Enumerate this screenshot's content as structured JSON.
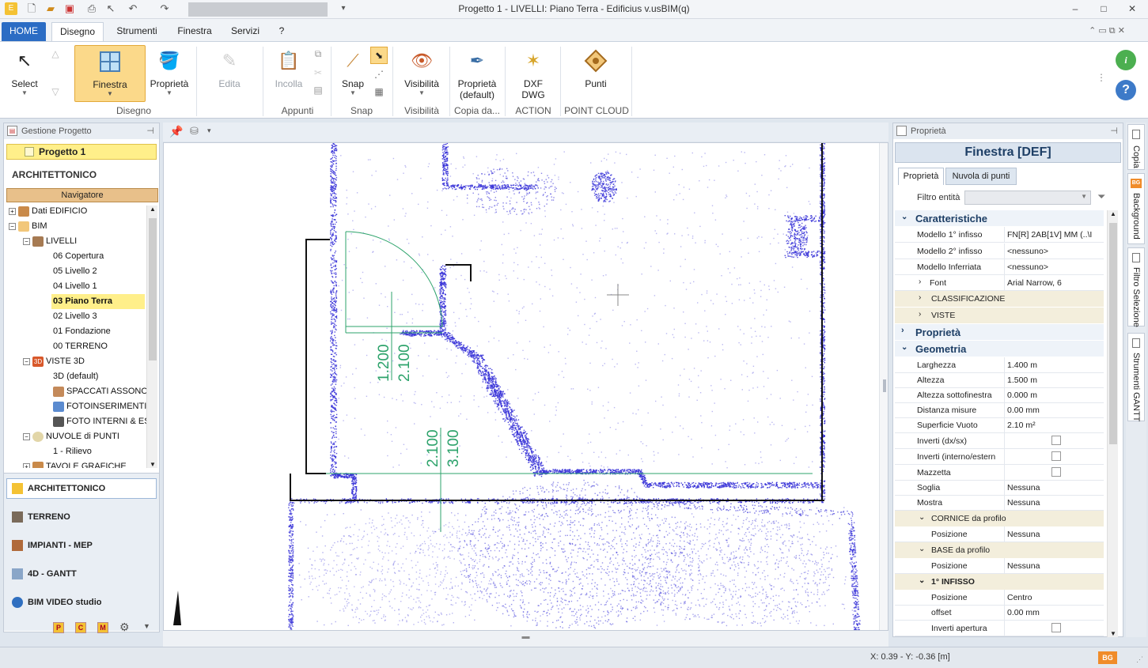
{
  "window": {
    "title": "Progetto 1 -  LIVELLI: Piano Terra - Edificius v.usBIM(q)",
    "controls": [
      "–",
      "□",
      "✕"
    ]
  },
  "tabs": [
    {
      "label": "HOME"
    },
    {
      "label": "Disegno"
    },
    {
      "label": "Strumenti"
    },
    {
      "label": "Finestra"
    },
    {
      "label": "Servizi"
    },
    {
      "label": "?"
    }
  ],
  "ribbon": {
    "select": "Select",
    "finestra": "Finestra",
    "proprieta": "Proprietà",
    "edita": "Edita",
    "incolla": "Incolla",
    "snap": "Snap",
    "visibilita": "Visibilità",
    "prop_default_1": "Proprietà",
    "prop_default_2": "(default)",
    "dxf_1": "DXF",
    "dxf_2": "DWG",
    "punti": "Punti",
    "groups": {
      "disegno": "Disegno",
      "appunti": "Appunti",
      "snap": "Snap",
      "visibilita": "Visibilità",
      "copia": "Copia da...",
      "action": "ACTION",
      "pointcloud": "POINT CLOUD"
    }
  },
  "left_panel": {
    "title": "Gestione Progetto",
    "project": "Progetto 1",
    "section": "ARCHITETTONICO",
    "navigator": "Navigatore",
    "tree": [
      {
        "label": "Dati EDIFICIO"
      },
      {
        "label": "BIM"
      },
      {
        "label": "LIVELLI"
      },
      {
        "label": "06 Copertura"
      },
      {
        "label": "05 Livello 2"
      },
      {
        "label": "04 Livello 1"
      },
      {
        "label": "03 Piano Terra"
      },
      {
        "label": "02 Livello 3"
      },
      {
        "label": "01 Fondazione"
      },
      {
        "label": "00 TERRENO"
      },
      {
        "label": "VISTE 3D"
      },
      {
        "label": "3D (default)"
      },
      {
        "label": "SPACCATI ASSONO"
      },
      {
        "label": "FOTOINSERIMENTI"
      },
      {
        "label": "FOTO INTERNI & ES"
      },
      {
        "label": "NUVOLE di PUNTI"
      },
      {
        "label": "1 - Rilievo"
      },
      {
        "label": "TAVOLE GRAFICHE"
      }
    ],
    "modules": [
      {
        "label": "ARCHITETTONICO"
      },
      {
        "label": "TERRENO"
      },
      {
        "label": "IMPIANTI - MEP"
      },
      {
        "label": "4D - GANTT"
      },
      {
        "label": "BIM VIDEO studio"
      }
    ],
    "bottom_badges": [
      "P",
      "C",
      "M"
    ]
  },
  "drawing": {
    "dim_a1": "1.200",
    "dim_a2": "2.100",
    "dim_b1": "2.100",
    "dim_b2": "3.100"
  },
  "right_panel": {
    "title": "Proprietà",
    "object": "Finestra [DEF]",
    "tabs": [
      "Proprietà",
      "Nuvola di punti"
    ],
    "filter_label": "Filtro entità",
    "sections": {
      "caratteristiche": "Caratteristiche",
      "proprieta": "Proprietà",
      "geometria": "Geometria"
    },
    "rows": {
      "modello1": {
        "k": "Modello 1° infisso",
        "v": "FN[R] 2AB[1V] MM  (..\\I"
      },
      "modello2": {
        "k": "Modello 2° infisso",
        "v": "<nessuno>"
      },
      "inferriata": {
        "k": "Modello Inferriata",
        "v": "<nessuno>"
      },
      "font": {
        "k": "Font",
        "v": "Arial Narrow, 6"
      },
      "classificazione": "CLASSIFICAZIONE",
      "viste": "VISTE",
      "larghezza": {
        "k": "Larghezza",
        "v": "1.400 m"
      },
      "altezza": {
        "k": "Altezza",
        "v": "1.500 m"
      },
      "sottofinestra": {
        "k": "Altezza sottofinestra",
        "v": "0.000 m"
      },
      "distanza": {
        "k": "Distanza misure",
        "v": "0.00 mm"
      },
      "superficie": {
        "k": "Superficie Vuoto",
        "v": "2.10 m²"
      },
      "invertidx": {
        "k": "Inverti (dx/sx)"
      },
      "invertiint": {
        "k": "Inverti (interno/estern"
      },
      "mazzetta": {
        "k": "Mazzetta"
      },
      "soglia": {
        "k": "Soglia",
        "v": "Nessuna"
      },
      "mostra": {
        "k": "Mostra",
        "v": "Nessuna"
      },
      "cornice": "CORNICE da profilo",
      "cornice_pos": {
        "k": "Posizione",
        "v": "Nessuna"
      },
      "base": "BASE da profilo",
      "base_pos": {
        "k": "Posizione",
        "v": "Nessuna"
      },
      "infisso": "1° INFISSO",
      "inf_pos": {
        "k": "Posizione",
        "v": "Centro"
      },
      "offset": {
        "k": "offset",
        "v": "0.00 mm"
      },
      "invapertura": {
        "k": "Inverti apertura"
      }
    }
  },
  "side_tabs": [
    "Copia",
    "Background",
    "Filtro Selezione",
    "Strumenti GANTT"
  ],
  "status": {
    "coords": "X: 0.39 - Y: -0.36 [m]",
    "badge": "BG"
  },
  "colors": {
    "accent": "#2b6cc4",
    "highlight": "#ffef8a",
    "navigator": "#e8c08a",
    "point_cloud": "#3a34d8",
    "dimension": "#2da36b"
  }
}
